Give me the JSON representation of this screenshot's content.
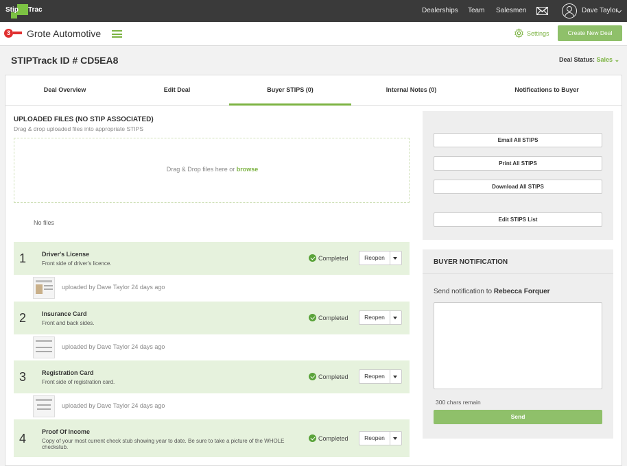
{
  "app": {
    "logo_left": "Stip",
    "logo_right": "Trac"
  },
  "topnav": {
    "items": [
      "Dealerships",
      "Team",
      "Salesmen"
    ],
    "user": "Dave Taylor"
  },
  "dealer": {
    "logo_char": "3",
    "name": "Grote Automotive",
    "settings_label": "Settings",
    "create_label": "Create New Deal"
  },
  "deal": {
    "id_label": "STIPTrack ID # CD5EA8",
    "status_label": "Deal Status:",
    "status_value": "Sales"
  },
  "tabs": [
    "Deal Overview",
    "Edit Deal",
    "Buyer STIPS (0)",
    "Internal Notes (0)",
    "Notifications to Buyer"
  ],
  "uploads": {
    "title": "UPLOADED FILES (NO STIP ASSOCIATED)",
    "subtitle": "Drag & drop uploaded files into appropriate STIPS",
    "drop_text": "Drag & Drop files here or ",
    "drop_link": "browse",
    "empty": "No files"
  },
  "stips": [
    {
      "num": "1",
      "title": "Driver's License",
      "desc": "Front side of driver's licence.",
      "status": "Completed",
      "action": "Reopen",
      "upload": "uploaded by Dave Taylor 24 days ago"
    },
    {
      "num": "2",
      "title": "Insurance Card",
      "desc": "Front and back sides.",
      "status": "Completed",
      "action": "Reopen",
      "upload": "uploaded by Dave Taylor 24 days ago"
    },
    {
      "num": "3",
      "title": "Registration Card",
      "desc": "Front side of registration card.",
      "status": "Completed",
      "action": "Reopen",
      "upload": "uploaded by Dave Taylor 24 days ago"
    },
    {
      "num": "4",
      "title": "Proof Of Income",
      "desc": "Copy of your most current check stub showing year to date. Be sure to take a picture of the WHOLE checkstub.",
      "status": "Completed",
      "action": "Reopen"
    }
  ],
  "actions": [
    "Email All STIPS",
    "Print All STIPS",
    "Download All STIPS",
    "Edit STIPS List"
  ],
  "notification": {
    "title": "BUYER NOTIFICATION",
    "to_prefix": "Send notification to ",
    "to_name": "Rebecca Forquer",
    "chars_remain": "300 chars remain",
    "send_label": "Send"
  },
  "colors": {
    "accent": "#7cb342",
    "topbar": "#3a3a3a",
    "row_bg": "#e6f2dd"
  }
}
